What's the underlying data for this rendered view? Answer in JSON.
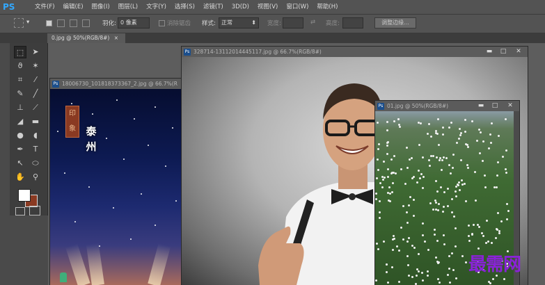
{
  "app": {
    "logo": "PS"
  },
  "menu": [
    "文件(F)",
    "编辑(E)",
    "图像(I)",
    "图层(L)",
    "文字(Y)",
    "选择(S)",
    "滤镜(T)",
    "3D(D)",
    "视图(V)",
    "窗口(W)",
    "帮助(H)"
  ],
  "options": {
    "feather_label": "羽化:",
    "feather_value": "0 像素",
    "antialias_label": "消除锯齿",
    "style_label": "样式:",
    "style_value": "正常",
    "width_label": "宽度:",
    "height_label": "高度:",
    "refine_edge_button": "调整边缘..."
  },
  "tabs": {
    "active": "0.jpg @ 50%(RGB/8#)",
    "close": "×"
  },
  "documents": {
    "doc1": {
      "title": "18006730_101818373367_2.jpg @ 66.7%(R"
    },
    "doc2": {
      "title": "328714-13112014445117.jpg @ 66.7%(RGB/8#)"
    },
    "doc3": {
      "title": "01.jpg @ 50%(RGB/8#)"
    }
  },
  "doc1_text": {
    "seal": "印象",
    "calligraphy_1": "泰",
    "calligraphy_2": "州"
  },
  "window_buttons": {
    "minimize": "▬",
    "restore": "□",
    "close": "✕"
  },
  "ps_badge": "Ps",
  "watermark": "最需网",
  "colors": {
    "menu_bg": "#535353",
    "toolbox_bg": "#3d3d3d",
    "ps_blue": "#31a8ff",
    "foreground": "#ffffff",
    "background": "#8a3a22"
  }
}
